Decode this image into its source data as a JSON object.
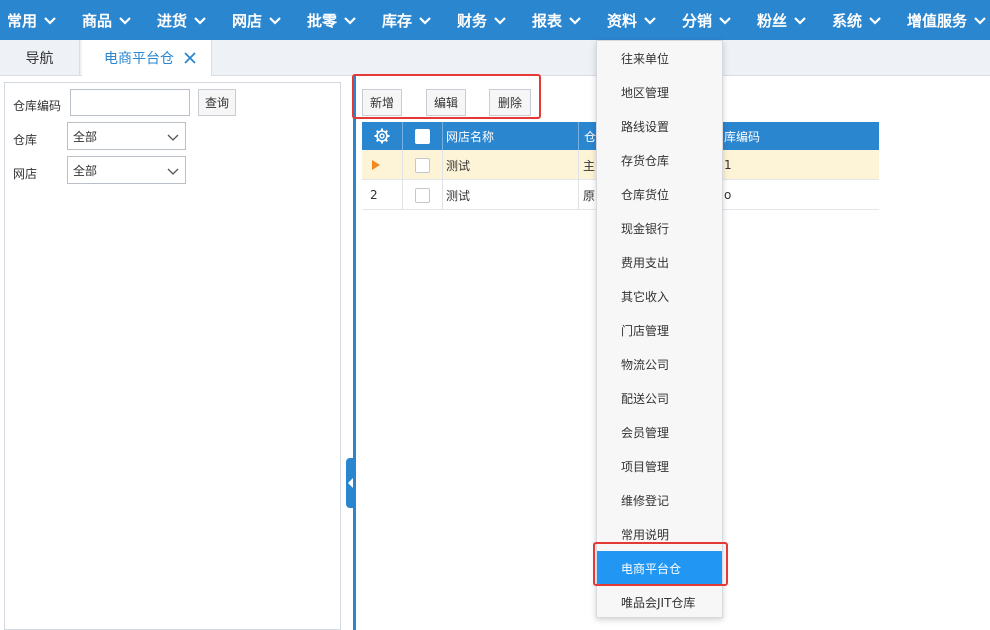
{
  "topnav": {
    "items": [
      {
        "label": "常用"
      },
      {
        "label": "商品"
      },
      {
        "label": "进货"
      },
      {
        "label": "网店"
      },
      {
        "label": "批零"
      },
      {
        "label": "库存"
      },
      {
        "label": "财务"
      },
      {
        "label": "报表"
      },
      {
        "label": "资料"
      },
      {
        "label": "分销"
      },
      {
        "label": "粉丝"
      },
      {
        "label": "系统"
      },
      {
        "label": "增值服务"
      }
    ],
    "bg_color": "#2b86d0"
  },
  "tabs": [
    {
      "label": "导航"
    },
    {
      "label": "电商平台仓"
    }
  ],
  "filters": {
    "code_label": "仓库编码",
    "code_value": "",
    "query_button": "查询",
    "warehouse_label": "仓库",
    "warehouse_value": "全部",
    "shop_label": "网店",
    "shop_value": "全部"
  },
  "toolbar": {
    "add": "新增",
    "edit": "编辑",
    "delete": "删除"
  },
  "grid": {
    "columns": [
      "网店名称",
      "仓",
      "库编码"
    ],
    "rows": [
      {
        "row_marker": "",
        "shop": "测试",
        "warehouse": "主",
        "code": "1",
        "selected": true
      },
      {
        "row_marker": "2",
        "shop": "测试",
        "warehouse": "原",
        "code": "o",
        "selected": false
      }
    ]
  },
  "dropdown": {
    "items": [
      "往来单位",
      "地区管理",
      "路线设置",
      "存货仓库",
      "仓库货位",
      "现金银行",
      "费用支出",
      "其它收入",
      "门店管理",
      "物流公司",
      "配送公司",
      "会员管理",
      "项目管理",
      "维修登记",
      "常用说明",
      "电商平台仓",
      "唯品会JIT仓库"
    ],
    "highlighted": "电商平台仓",
    "highlight_color": "#2196f3"
  },
  "colors": {
    "accent": "#2b86d0",
    "annotation_red": "#e53935"
  }
}
